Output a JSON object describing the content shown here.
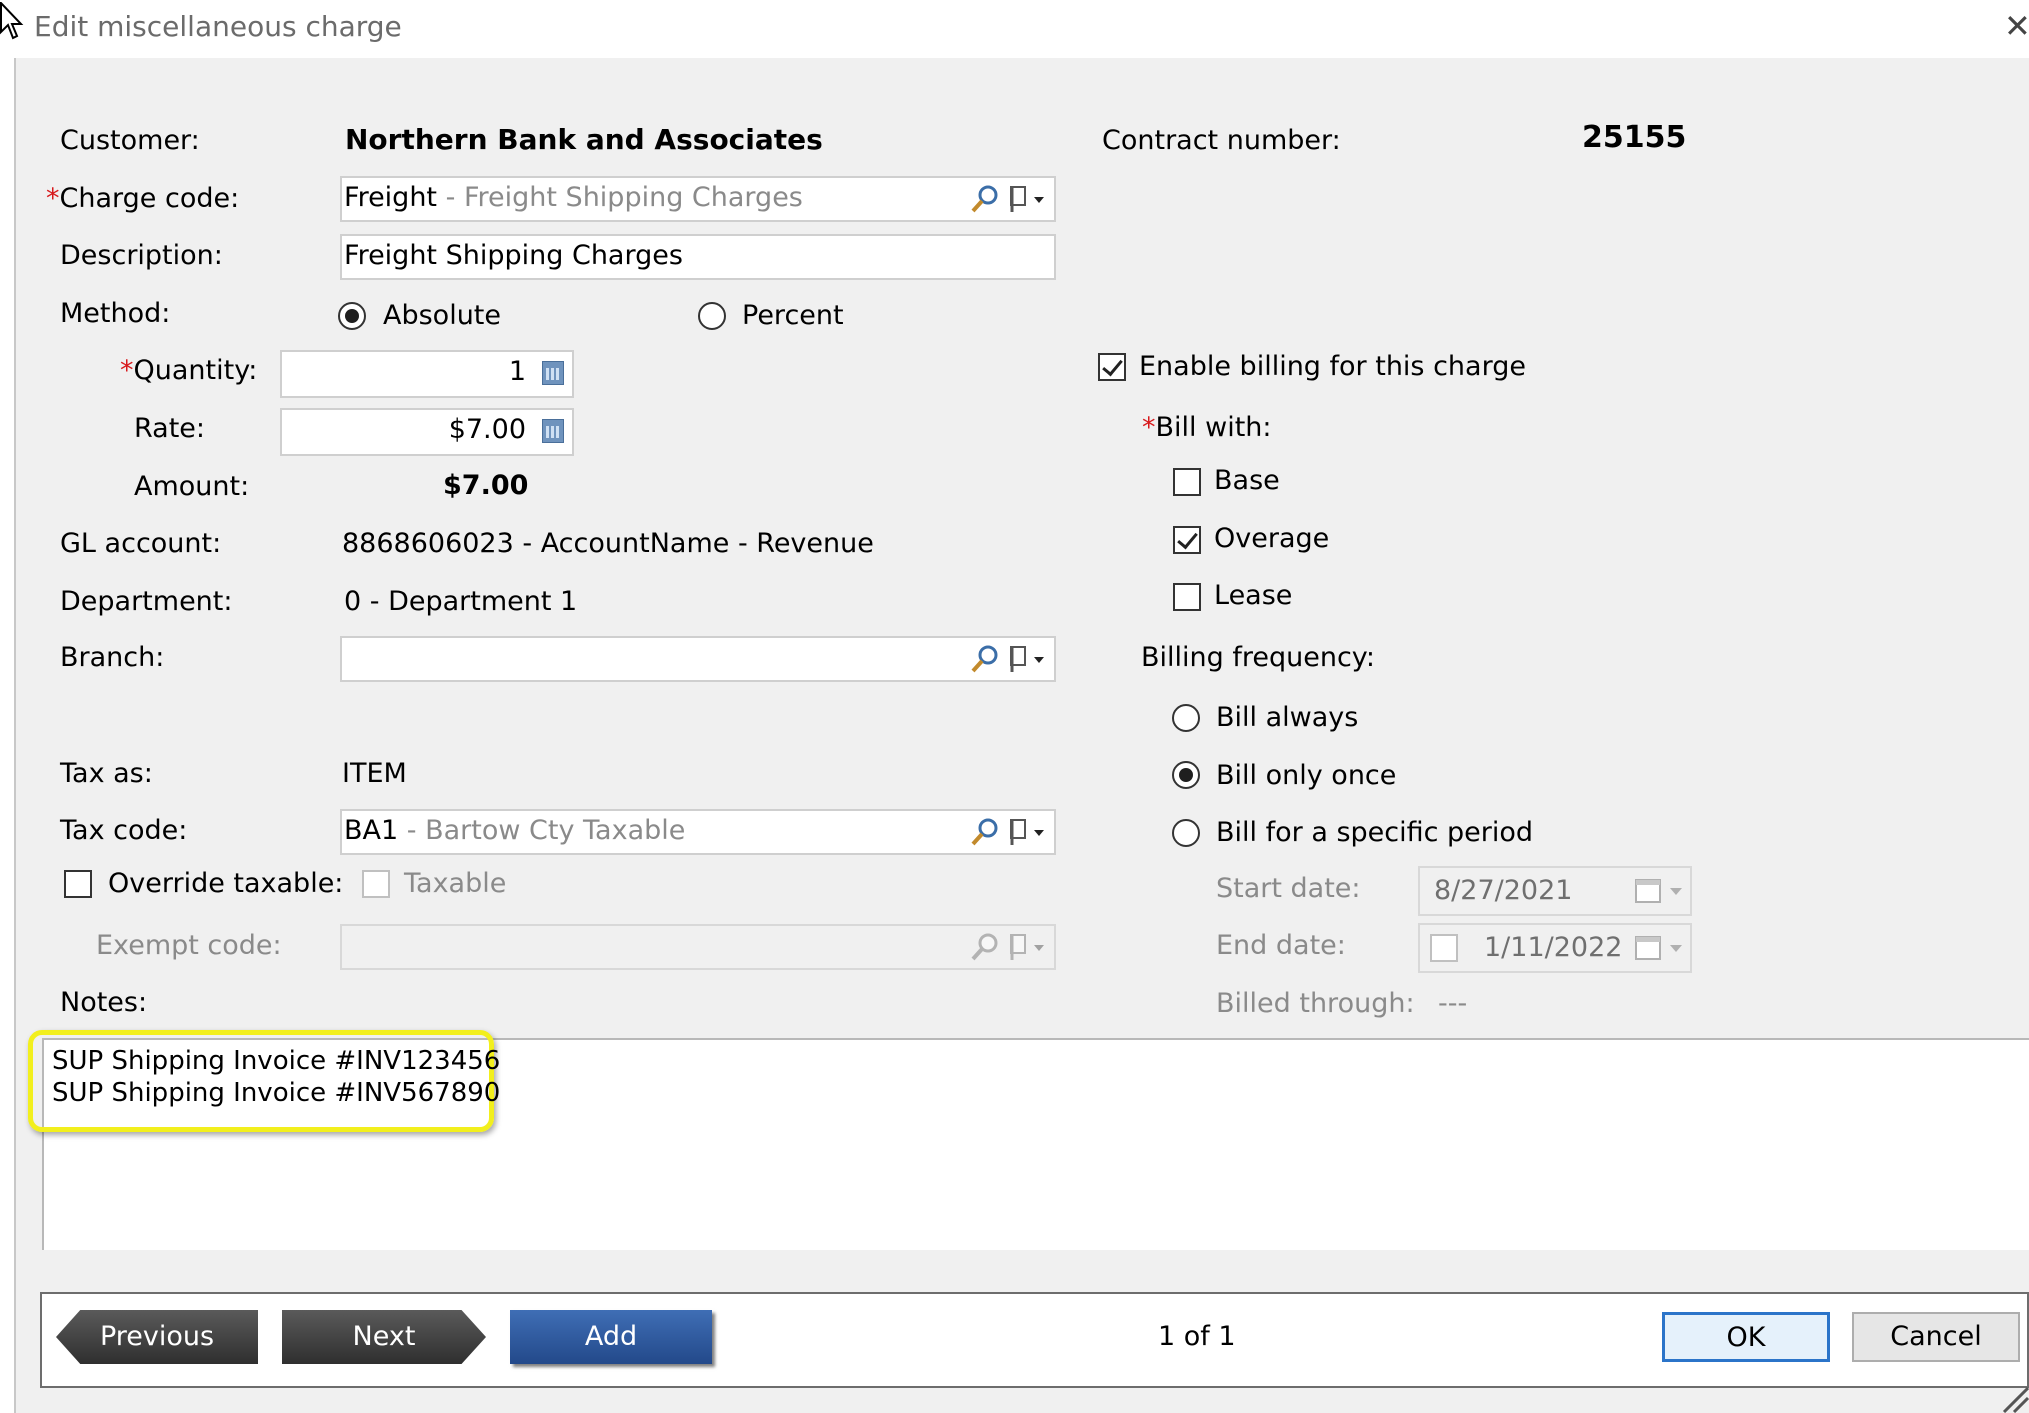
{
  "window": {
    "title": "Edit miscellaneous charge",
    "close_glyph": "✕"
  },
  "customer": {
    "label": "Customer:",
    "value": "Northern Bank and Associates"
  },
  "contract": {
    "label": "Contract number:",
    "value": "25155"
  },
  "charge_code": {
    "required_mark": "*",
    "label": "Charge code:",
    "code": "Freight",
    "separator": " - ",
    "name": "Freight Shipping Charges"
  },
  "description": {
    "label": "Description:",
    "value": "Freight Shipping Charges"
  },
  "method": {
    "label": "Method:",
    "options": [
      "Absolute",
      "Percent"
    ],
    "selected": "Absolute"
  },
  "quantity": {
    "required_mark": "*",
    "label": "Quantity:",
    "value": "1"
  },
  "rate": {
    "label": "Rate:",
    "value": "$7.00"
  },
  "amount": {
    "label": "Amount:",
    "value": "$7.00"
  },
  "gl_account": {
    "label": "GL account:",
    "value": "8868606023 - AccountName - Revenue"
  },
  "department": {
    "label": "Department:",
    "value": "0 - Department 1"
  },
  "branch": {
    "label": "Branch:",
    "value": ""
  },
  "tax_as": {
    "label": "Tax as:",
    "value": "ITEM"
  },
  "tax_code": {
    "label": "Tax code:",
    "code": "BA1",
    "separator": " - ",
    "name": "Bartow Cty Taxable"
  },
  "override_taxable": {
    "label": "Override taxable:",
    "checked": false
  },
  "taxable": {
    "label": "Taxable",
    "checked": false,
    "enabled": false
  },
  "exempt_code": {
    "label": "Exempt code:",
    "value": ""
  },
  "notes": {
    "label": "Notes:",
    "lines": [
      "SUP Shipping Invoice #INV123456",
      "SUP Shipping Invoice #INV567890"
    ]
  },
  "billing": {
    "enable_label": "Enable billing for this charge",
    "enabled": true,
    "bill_with_required_mark": "*",
    "bill_with_label": "Bill with:",
    "bill_with": [
      {
        "label": "Base",
        "checked": false
      },
      {
        "label": "Overage",
        "checked": true
      },
      {
        "label": "Lease",
        "checked": false
      }
    ],
    "frequency_label": "Billing frequency:",
    "frequency_options": [
      "Bill always",
      "Bill only once",
      "Bill for a specific period"
    ],
    "frequency_selected": "Bill only once",
    "start_date": {
      "label": "Start date:",
      "value": "8/27/2021"
    },
    "end_date": {
      "label": "End date:",
      "value": "1/11/2022",
      "checked": false
    },
    "billed_through": {
      "label": "Billed through:",
      "value": "---"
    }
  },
  "footer": {
    "previous": "Previous",
    "next": "Next",
    "add": "Add",
    "pager": "1 of 1",
    "ok": "OK",
    "cancel": "Cancel"
  },
  "colors": {
    "required": "#d7191c",
    "highlight": "#f2ef1d",
    "add_button": "#2f5ea5",
    "nav_button": "#404040",
    "ok_border": "#2b74c9"
  },
  "icons": {
    "lookup": "magnifier-icon",
    "flag": "flag-dropdown-icon",
    "calculator": "calculator-icon",
    "calendar": "calendar-icon"
  }
}
